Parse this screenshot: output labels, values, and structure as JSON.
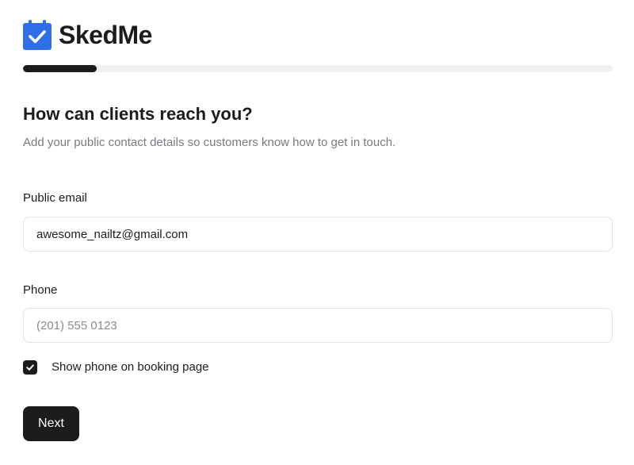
{
  "brand": {
    "name": "SkedMe",
    "icon": "calendar-check-icon",
    "accent_color": "#2f6fea"
  },
  "progress": {
    "fraction": 0.125
  },
  "step": {
    "title": "How can clients reach you?",
    "description": "Add your public contact details so customers know how to get in touch."
  },
  "form": {
    "email": {
      "label": "Public email",
      "value": "awesome_nailtz@gmail.com"
    },
    "phone": {
      "label": "Phone",
      "value": "",
      "placeholder": "(201) 555 0123"
    },
    "show_phone": {
      "label": "Show phone on booking page",
      "checked": true
    }
  },
  "actions": {
    "next_label": "Next"
  }
}
